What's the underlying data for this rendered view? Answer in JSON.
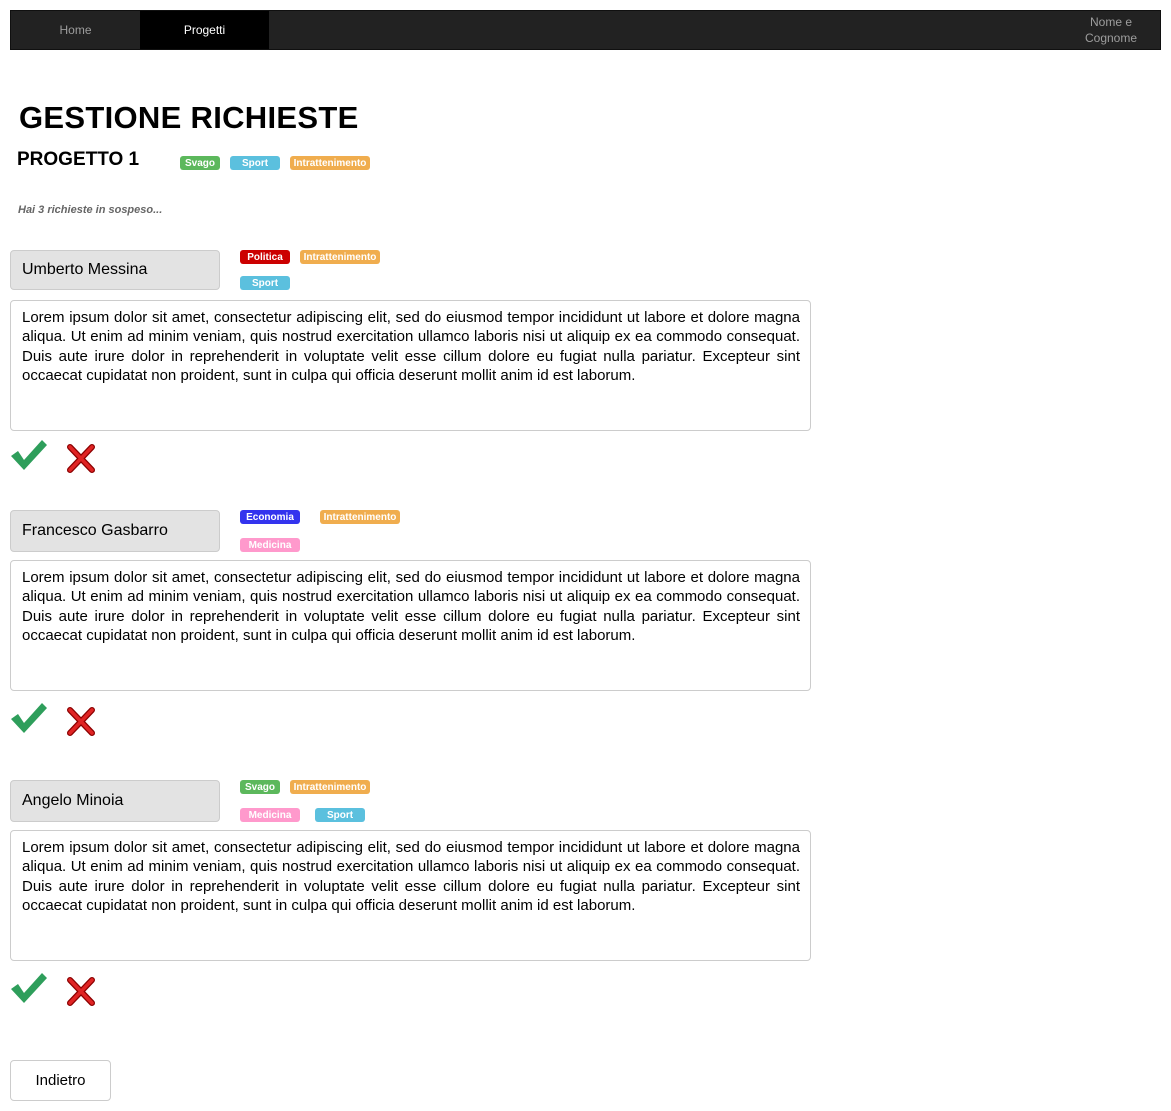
{
  "nav": {
    "home_label": "Home",
    "projects_label": "Progetti",
    "user_line1": "Nome e",
    "user_line2": "Cognome"
  },
  "page_title": "GESTIONE RICHIESTE",
  "project": {
    "title": "PROGETTO 1",
    "tags": [
      "Svago",
      "Sport",
      "Intrattenimento"
    ]
  },
  "pending_text": "Hai 3 richieste in sospeso...",
  "requests": [
    {
      "name": "Umberto Messina",
      "tags": [
        "Politica",
        "Intrattenimento",
        "Sport"
      ],
      "text": "Lorem ipsum dolor sit amet, consectetur adipiscing elit, sed do eiusmod tempor incididunt ut labore et dolore magna aliqua. Ut enim ad minim veniam, quis nostrud exercitation ullamco laboris nisi ut aliquip ex ea commodo consequat. Duis aute irure dolor in reprehenderit in voluptate velit esse cillum dolore eu fugiat nulla pariatur. Excepteur sint occaecat cupidatat non proident, sunt in culpa qui officia deserunt mollit anim id est laborum."
    },
    {
      "name": "Francesco Gasbarro",
      "tags": [
        "Economia",
        "Intrattenimento",
        "Medicina"
      ],
      "text": "Lorem ipsum dolor sit amet, consectetur adipiscing elit, sed do eiusmod tempor incididunt ut labore et dolore magna aliqua. Ut enim ad minim veniam, quis nostrud exercitation ullamco laboris nisi ut aliquip ex ea commodo consequat. Duis aute irure dolor in reprehenderit in voluptate velit esse cillum dolore eu fugiat nulla pariatur. Excepteur sint occaecat cupidatat non proident, sunt in culpa qui officia deserunt mollit anim id est laborum."
    },
    {
      "name": "Angelo Minoia",
      "tags": [
        "Svago",
        "Intrattenimento",
        "Medicina",
        "Sport"
      ],
      "text": "Lorem ipsum dolor sit amet, consectetur adipiscing elit, sed do eiusmod tempor incididunt ut labore et dolore magna aliqua. Ut enim ad minim veniam, quis nostrud exercitation ullamco laboris nisi ut aliquip ex ea commodo consequat. Duis aute irure dolor in reprehenderit in voluptate velit esse cillum dolore eu fugiat nulla pariatur. Excepteur sint occaecat cupidatat non proident, sunt in culpa qui officia deserunt mollit anim id est laborum."
    }
  ],
  "icons": {
    "accept": "checkmark-icon",
    "reject": "close-icon"
  },
  "colors": {
    "navbar": "#222222",
    "tag_svago": "#5cb85c",
    "tag_sport": "#5bc0de",
    "tag_intrattenimento": "#f0ad4e",
    "tag_politica": "#cc0000",
    "tag_economia": "#3333ee",
    "tag_medicina": "#ff99cc",
    "accept": "#2e9e5b",
    "reject": "#dd2222"
  },
  "back_label": "Indietro"
}
